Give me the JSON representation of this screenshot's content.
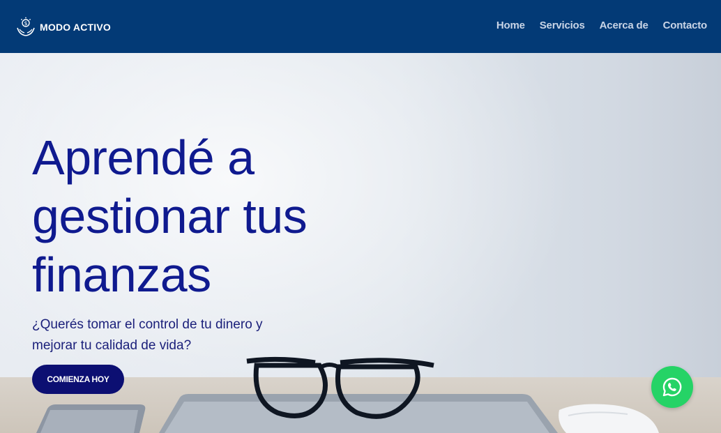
{
  "brand": {
    "name": "MODO ACTIVO",
    "logo_icon": "hands-coin-icon"
  },
  "nav": {
    "items": [
      {
        "label": "Home"
      },
      {
        "label": "Servicios"
      },
      {
        "label": "Acerca de"
      },
      {
        "label": "Contacto"
      }
    ]
  },
  "hero": {
    "headline": "Aprendé a gestionar tus finanzas",
    "subtitle": "¿Querés tomar el control de tu dinero y mejorar tu calidad de vida?",
    "cta_label": "COMIENZA HOY"
  },
  "floating": {
    "whatsapp_icon": "whatsapp-icon"
  },
  "colors": {
    "navbar": "#033a76",
    "headline": "#0f1a8f",
    "cta": "#0c0f72",
    "whatsapp": "#25d366"
  }
}
